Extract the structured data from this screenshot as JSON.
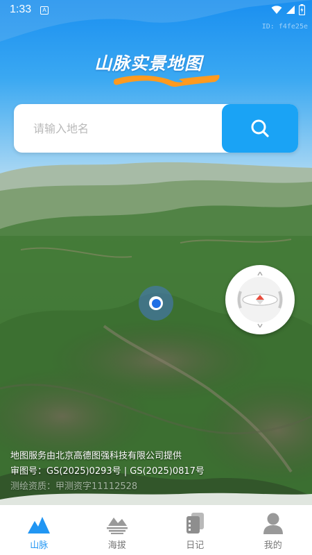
{
  "status_bar": {
    "time": "1:33",
    "sim_letter": "A",
    "device_id": "ID: f4fe25e"
  },
  "app": {
    "title": "山脉实景地图",
    "accent_color": "#1aa3f5",
    "logo_swoosh_color": "#ff9a1f"
  },
  "search": {
    "placeholder": "请输入地名",
    "value": "",
    "button_icon": "search-icon"
  },
  "map": {
    "location_marker_icon": "location-dot-icon",
    "compass_icon": "compass-icon",
    "attribution": {
      "line1": "地图服务由北京高德图强科技有限公司提供",
      "line2": "审图号：GS(2025)0293号 | GS(2025)0817号",
      "line3": "测绘资质：甲测资字11112528"
    }
  },
  "tabs": [
    {
      "label": "山脉",
      "icon": "mountain-icon",
      "active": true
    },
    {
      "label": "海拔",
      "icon": "altitude-icon",
      "active": false
    },
    {
      "label": "日记",
      "icon": "notebook-icon",
      "active": false
    },
    {
      "label": "我的",
      "icon": "user-icon",
      "active": false
    }
  ]
}
